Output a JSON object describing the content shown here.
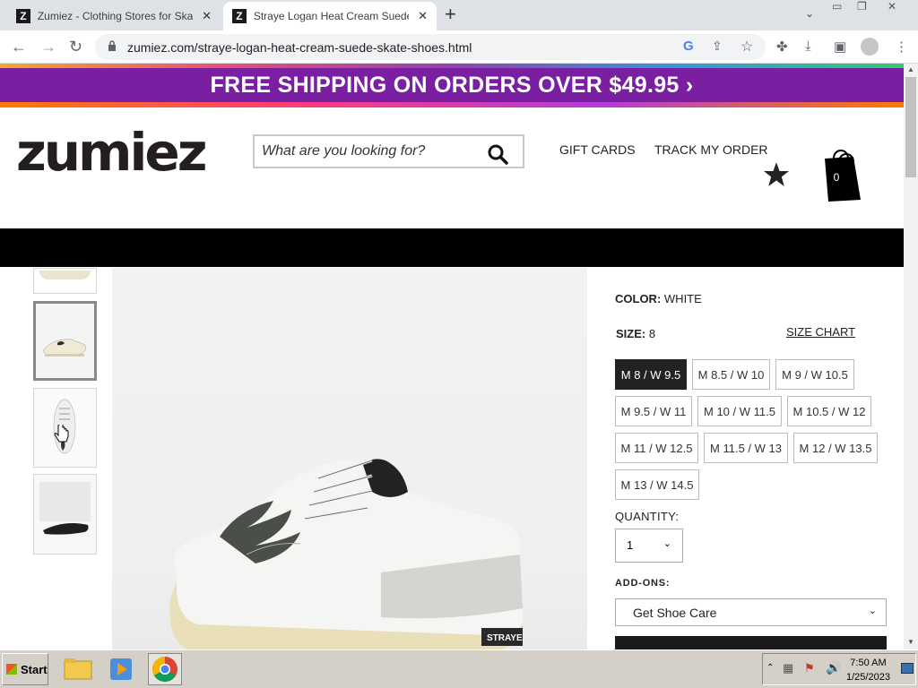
{
  "browser": {
    "tabs": [
      {
        "favicon": "Z",
        "title": "Zumiez - Clothing Stores for Skate s",
        "active": false
      },
      {
        "favicon": "Z",
        "title": "Straye Logan Heat Cream Suede Sk",
        "active": true
      }
    ],
    "url": "zumiez.com/straye-logan-heat-cream-suede-skate-shoes.html"
  },
  "banner": {
    "text": "FREE SHIPPING ON ORDERS OVER $49.95 ›"
  },
  "header": {
    "logo": "zumiez",
    "search_placeholder": "What are you looking for?",
    "links": {
      "gift_cards": "GIFT CARDS",
      "track_order": "TRACK MY ORDER"
    },
    "cart_count": "0"
  },
  "product": {
    "color_label": "COLOR:",
    "color_value": "WHITE",
    "size_label": "SIZE:",
    "size_value": "8",
    "size_chart": "SIZE CHART",
    "sizes": [
      "M 8 / W 9.5",
      "M 8.5 / W 10",
      "M 9 / W 10.5",
      "M 9.5 / W 11",
      "M 10 / W 11.5",
      "M 10.5 / W 12",
      "M 11 / W 12.5",
      "M 11.5 / W 13",
      "M 12 / W 13.5",
      "M 13 / W 14.5"
    ],
    "quantity_label": "QUANTITY:",
    "quantity_value": "1",
    "addons_label": "ADD-ONS:",
    "addon_value": "Get Shoe Care",
    "shoe_brand_text": "STRAYE"
  },
  "taskbar": {
    "start_label": "Start",
    "time": "7:50 AM",
    "date": "1/25/2023"
  }
}
